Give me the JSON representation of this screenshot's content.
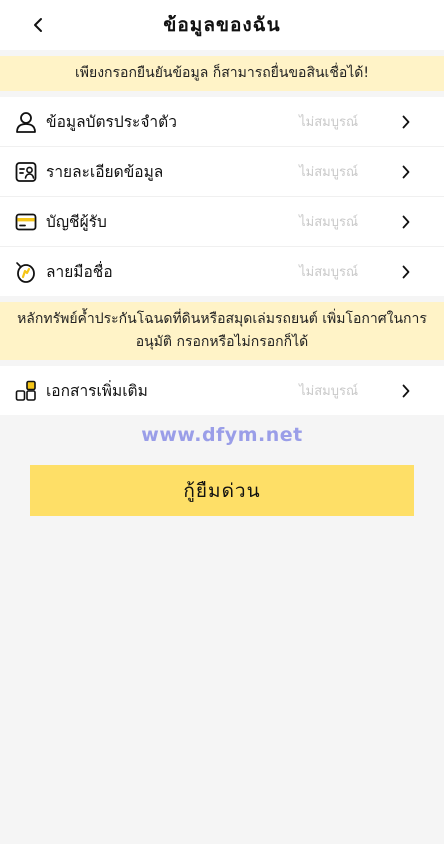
{
  "header": {
    "title": "ข้อมูลของฉัน"
  },
  "notice_top": "เพียงกรอกยืนยันข้อมูล ก็สามารถยื่นขอสินเชื่อได้!",
  "rows": [
    {
      "label": "ข้อมูลบัตรประจำตัว",
      "status": "ไม่สมบูรณ์",
      "icon": "person-icon"
    },
    {
      "label": "รายละเอียดข้อมูล",
      "status": "ไม่สมบูรณ์",
      "icon": "id-card-icon"
    },
    {
      "label": "บัญชีผู้รับ",
      "status": "ไม่สมบูรณ์",
      "icon": "credit-card-icon"
    },
    {
      "label": "ลายมือชื่อ",
      "status": "ไม่สมบูรณ์",
      "icon": "signature-icon"
    }
  ],
  "notice_collateral": "หลักทรัพย์ค้ำประกันโฉนดที่ดินหรือสมุดเล่มรถยนต์ เพิ่มโอกาศในการอนุมัติ กรอกหรือไม่กรอกก็ได้",
  "extra_row": {
    "label": "เอกสารเพิ่มเติม",
    "status": "ไม่สมบูรณ์",
    "icon": "documents-icon"
  },
  "watermark": "www.dfym.net",
  "cta_label": "กู้ยืมด่วน",
  "colors": {
    "accent": "#fedf67",
    "notice_bg": "#fff3c7",
    "status_text": "#c9c9c9",
    "icon_accent": "#f5c518"
  }
}
